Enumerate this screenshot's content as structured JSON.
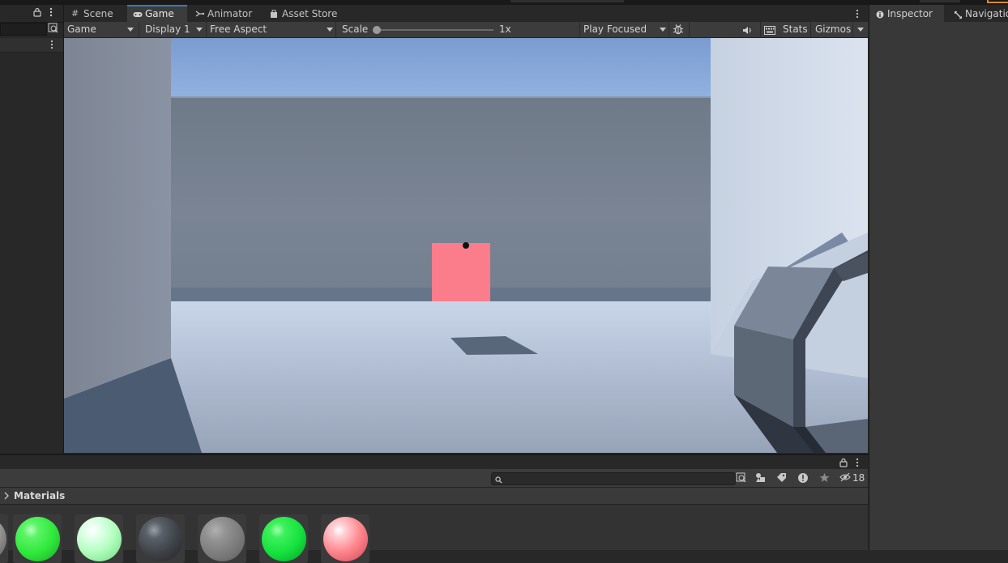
{
  "game_panel": {
    "tabs": [
      {
        "label": "Scene",
        "icon": "grid-icon"
      },
      {
        "label": "Game",
        "icon": "gamepad-icon",
        "active": true
      },
      {
        "label": "Animator",
        "icon": "animator-icon"
      },
      {
        "label": "Asset Store",
        "icon": "bag-icon"
      }
    ],
    "toolbar": {
      "game_dropdown": "Game",
      "display_dropdown": "Display 1",
      "aspect_dropdown": "Free Aspect",
      "scale_label": "Scale",
      "scale_value": "1x",
      "play_mode_dropdown": "Play Focused",
      "stats_label": "Stats",
      "gizmos_label": "Gizmos"
    }
  },
  "inspector_panel": {
    "tabs": [
      {
        "label": "Inspector",
        "icon": "info-icon"
      },
      {
        "label": "Navigation",
        "icon": "navigation-icon"
      }
    ]
  },
  "project_panel": {
    "breadcrumb": "Materials",
    "hidden_count": "18",
    "materials": [
      {
        "color": "#2ee83a"
      },
      {
        "color": "#b4ffc0"
      },
      {
        "color": "#3e4248"
      },
      {
        "color": "#8a8a8a"
      },
      {
        "color": "#14e23e"
      },
      {
        "color": "#ff8890"
      }
    ]
  },
  "colors": {
    "accent": "#3a79bb",
    "panel_dark": "#282828",
    "toolbar": "#3c3c3c",
    "sky": "#86a4d6",
    "target_cube": "#fb7d8c"
  }
}
